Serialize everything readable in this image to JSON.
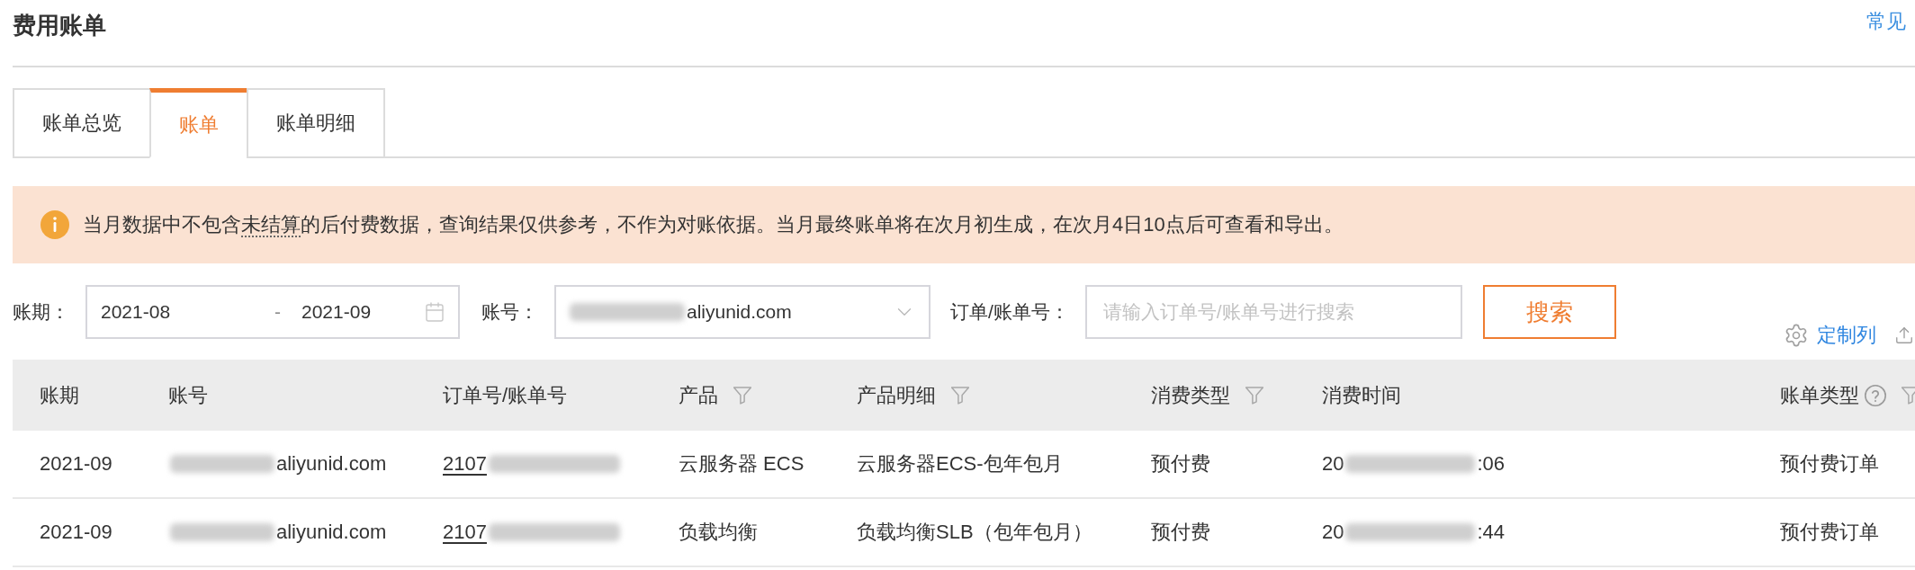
{
  "header": {
    "title": "费用账单",
    "help_link": "常见"
  },
  "tabs": [
    {
      "label": "账单总览",
      "selected": false
    },
    {
      "label": "账单",
      "selected": true
    },
    {
      "label": "账单明细",
      "selected": false
    }
  ],
  "notice": {
    "text_before": "当月数据中不包含",
    "term": "未结算",
    "text_after": "的后付费数据，查询结果仅供参考，不作为对账依据。当月最终账单将在次月初生成，在次月4日10点后可查看和导出。"
  },
  "filters": {
    "period": {
      "label": "账期：",
      "start": "2021-08",
      "separator": "-",
      "end": "2021-09"
    },
    "account": {
      "label": "账号：",
      "value": [
        {
          "kind": "redacted"
        },
        {
          "kind": "text",
          "text": "aliyunid.com"
        }
      ]
    },
    "order": {
      "label": "订单/账单号：",
      "placeholder": "请输入订单号/账单号进行搜索"
    },
    "search_button": "搜索"
  },
  "toolbar": {
    "customize_columns": "定制列"
  },
  "table": {
    "columns": [
      {
        "label": "账期",
        "kind": "text",
        "filter": false,
        "help": false
      },
      {
        "label": "账号",
        "kind": "text",
        "filter": false,
        "help": false
      },
      {
        "label": "订单号/账单号",
        "kind": "link",
        "filter": false,
        "help": false
      },
      {
        "label": "产品",
        "kind": "text",
        "filter": true,
        "help": false
      },
      {
        "label": "产品明细",
        "kind": "text",
        "filter": true,
        "help": false
      },
      {
        "label": "消费类型",
        "kind": "text",
        "filter": true,
        "help": false
      },
      {
        "label": "消费时间",
        "kind": "text",
        "filter": false,
        "help": false
      },
      {
        "label": "账单类型",
        "kind": "text",
        "filter": true,
        "help": true
      }
    ],
    "rows": [
      {
        "cells": [
          "2021-09",
          [
            {
              "kind": "redacted"
            },
            {
              "kind": "text",
              "text": "aliyunid.com"
            }
          ],
          [
            {
              "kind": "text",
              "text": "2107"
            },
            {
              "kind": "redacted"
            }
          ],
          "云服务器 ECS",
          "云服务器ECS-包年包月",
          "预付费",
          [
            {
              "kind": "text",
              "text": "20"
            },
            {
              "kind": "redacted"
            },
            {
              "kind": "text",
              "text": ":06"
            }
          ],
          "预付费订单"
        ]
      },
      {
        "cells": [
          "2021-09",
          [
            {
              "kind": "redacted"
            },
            {
              "kind": "text",
              "text": "aliyunid.com"
            }
          ],
          [
            {
              "kind": "text",
              "text": "2107"
            },
            {
              "kind": "redacted"
            }
          ],
          "负载均衡",
          "负载均衡SLB（包年包月）",
          "预付费",
          [
            {
              "kind": "text",
              "text": "20"
            },
            {
              "kind": "redacted"
            },
            {
              "kind": "text",
              "text": ":44"
            }
          ],
          "预付费订单"
        ]
      }
    ]
  }
}
